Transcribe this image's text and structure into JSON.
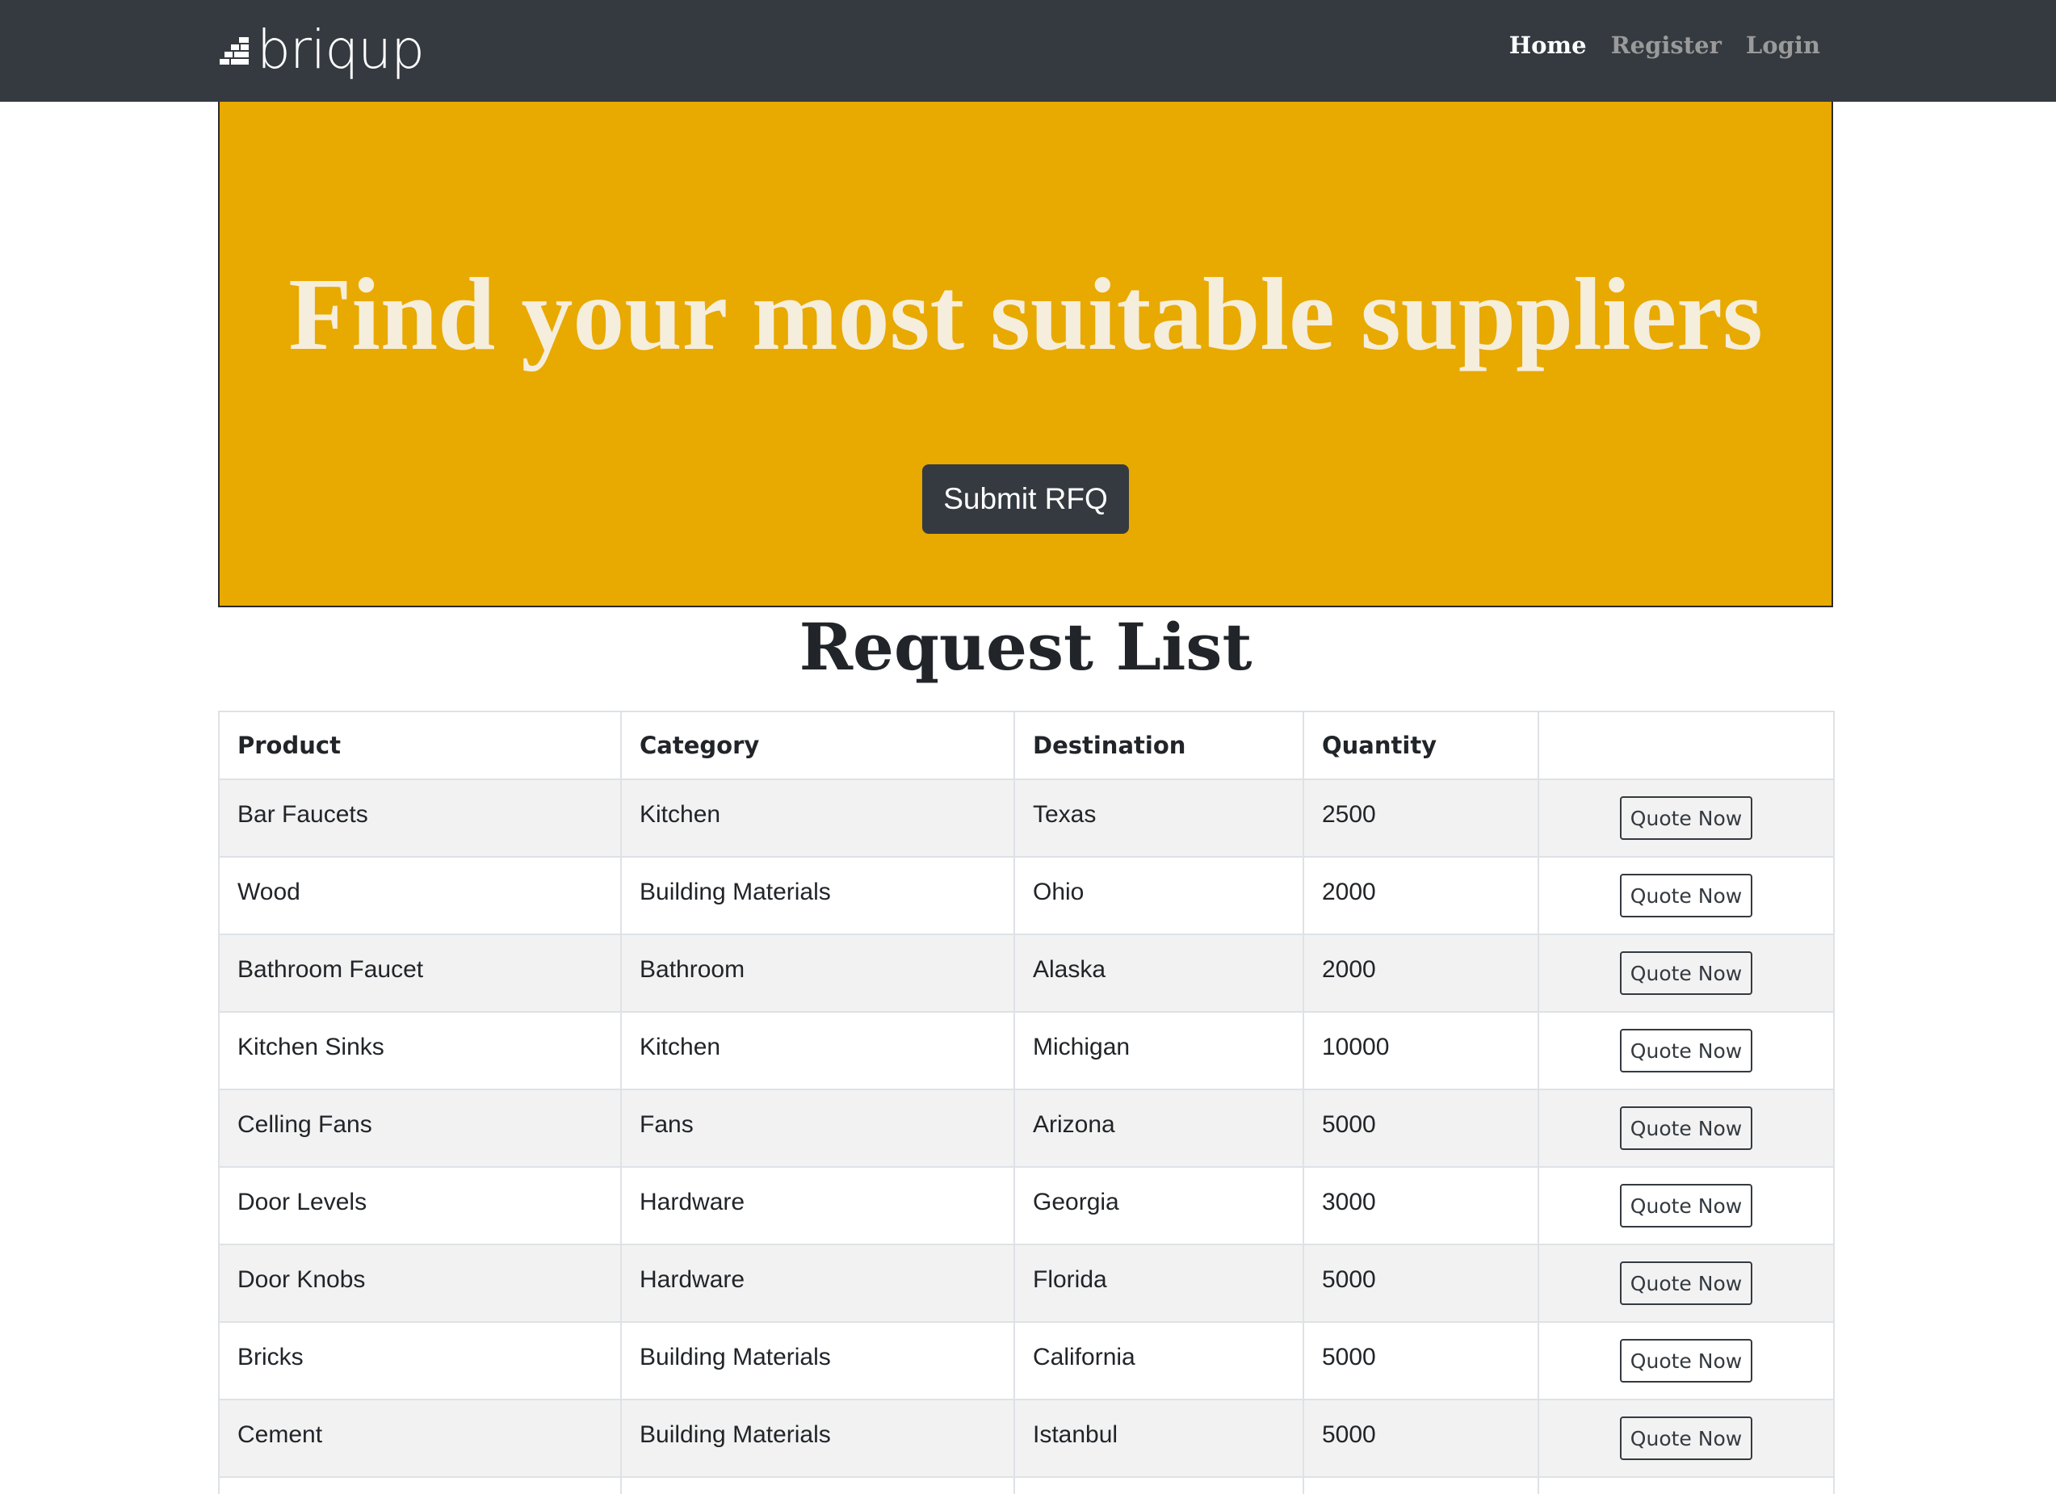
{
  "navbar": {
    "logo_text": "briqup",
    "links": [
      {
        "label": "Home",
        "active": true
      },
      {
        "label": "Register",
        "active": false
      },
      {
        "label": "Login",
        "active": false
      }
    ]
  },
  "hero": {
    "title": "Find your most suitable suppliers",
    "button_label": "Submit RFQ",
    "background_color": "#e8a900"
  },
  "request_list": {
    "title": "Request List",
    "columns": [
      "Product",
      "Category",
      "Destination",
      "Quantity",
      ""
    ],
    "action_label": "Quote Now",
    "rows": [
      {
        "product": "Bar Faucets",
        "category": "Kitchen",
        "destination": "Texas",
        "quantity": "2500"
      },
      {
        "product": "Wood",
        "category": "Building Materials",
        "destination": "Ohio",
        "quantity": "2000"
      },
      {
        "product": "Bathroom Faucet",
        "category": "Bathroom",
        "destination": "Alaska",
        "quantity": "2000"
      },
      {
        "product": "Kitchen Sinks",
        "category": "Kitchen",
        "destination": "Michigan",
        "quantity": "10000"
      },
      {
        "product": "Celling Fans",
        "category": "Fans",
        "destination": "Arizona",
        "quantity": "5000"
      },
      {
        "product": "Door Levels",
        "category": "Hardware",
        "destination": "Georgia",
        "quantity": "3000"
      },
      {
        "product": "Door Knobs",
        "category": "Hardware",
        "destination": "Florida",
        "quantity": "5000"
      },
      {
        "product": "Bricks",
        "category": "Building Materials",
        "destination": "California",
        "quantity": "5000"
      },
      {
        "product": "Cement",
        "category": "Building Materials",
        "destination": "Istanbul",
        "quantity": "5000"
      },
      {
        "product": "",
        "category": "",
        "destination": "",
        "quantity": ""
      }
    ]
  }
}
